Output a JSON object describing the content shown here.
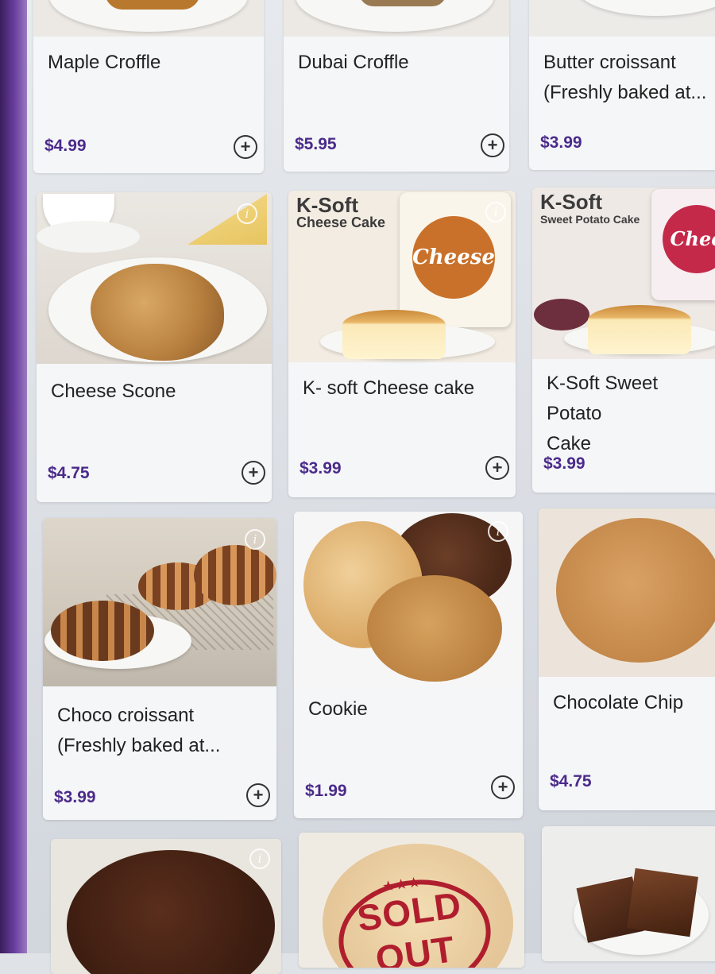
{
  "menu": {
    "items": [
      {
        "name": "Maple Croffle",
        "price": "$4.99"
      },
      {
        "name": "Dubai Croffle",
        "price": "$5.95"
      },
      {
        "name": "Butter croissant\n(Freshly baked at...",
        "price": "$3.99"
      },
      {
        "name": "Cheese Scone",
        "price": "$4.75"
      },
      {
        "name": "K- soft Cheese cake",
        "price": "$3.99"
      },
      {
        "name": "K-Soft Sweet Potato\nCake",
        "price": "$3.99"
      },
      {
        "name": "Choco croissant\n(Freshly baked at...",
        "price": "$3.99"
      },
      {
        "name": "Cookie",
        "price": "$1.99"
      },
      {
        "name": "Chocolate Chip",
        "price": "$4.75"
      }
    ],
    "add_icon": "plus-circle-icon",
    "info_icon": "info-icon",
    "info_glyph": "i",
    "add_glyph": "+"
  },
  "packaging": {
    "cheese_cake": {
      "brand": "K-Soft",
      "product": "Cheese Cake",
      "badge": "Cheese"
    },
    "sweet_potato": {
      "brand": "K-Soft",
      "product": "Sweet Potato Cake",
      "badge": "Chee"
    }
  },
  "sold_out": {
    "label": "SOLD OUT",
    "stars": "★★★"
  },
  "colors": {
    "price": "#4b2a8a",
    "sold_out": "#b01e2e",
    "bezel": "#6b3fa0"
  }
}
